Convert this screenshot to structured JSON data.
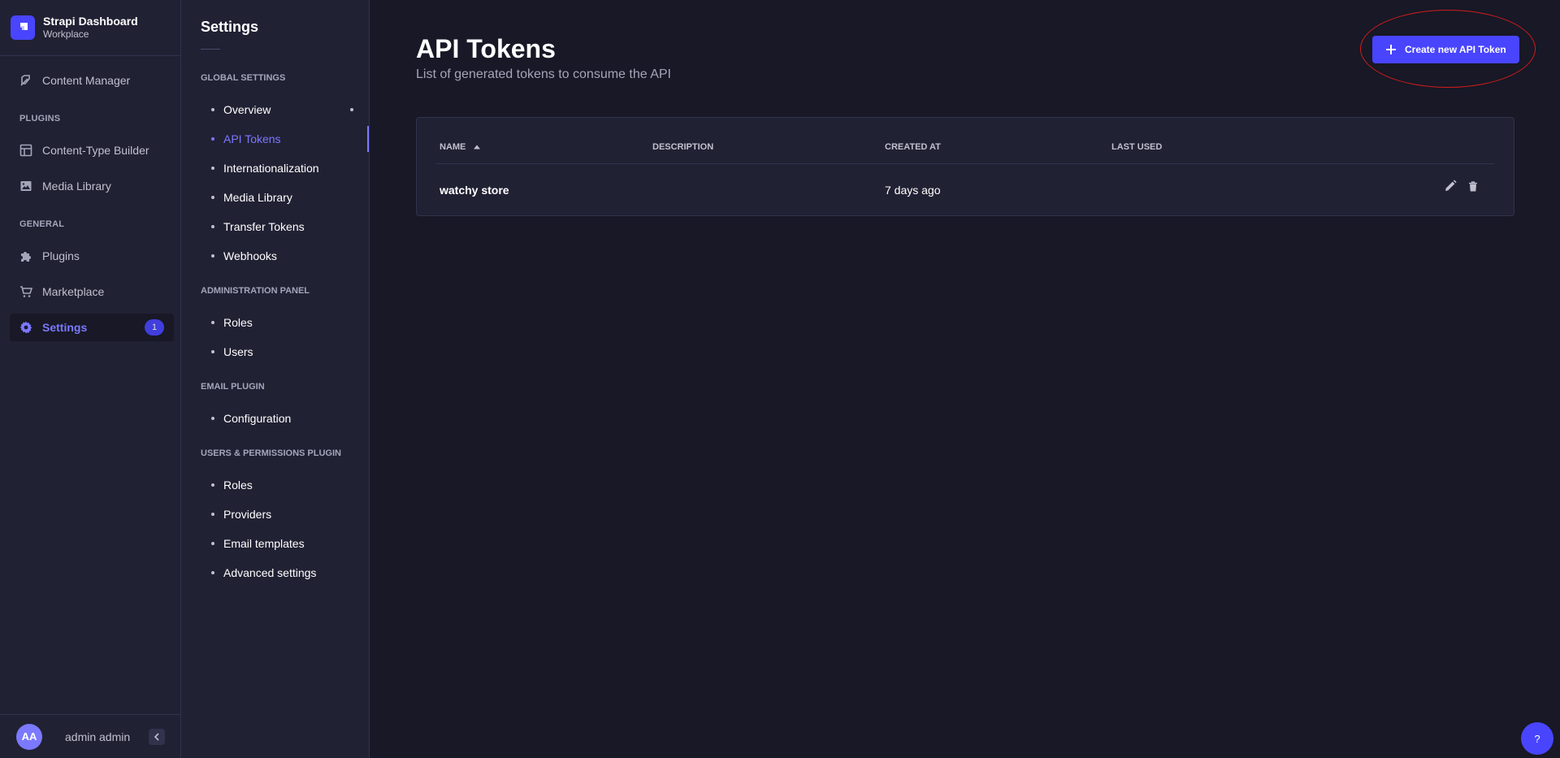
{
  "brand": {
    "title": "Strapi Dashboard",
    "subtitle": "Workplace"
  },
  "mainnav": {
    "content_manager": "Content Manager",
    "plugins_section": "PLUGINS",
    "ctb": "Content-Type Builder",
    "media_library": "Media Library",
    "general_section": "GENERAL",
    "plugins": "Plugins",
    "marketplace": "Marketplace",
    "settings": "Settings",
    "settings_badge": "1"
  },
  "user": {
    "initials": "AA",
    "name": "admin admin"
  },
  "subnav": {
    "title": "Settings",
    "global_section": "GLOBAL SETTINGS",
    "overview": "Overview",
    "api_tokens": "API Tokens",
    "i18n": "Internationalization",
    "media_library": "Media Library",
    "transfer_tokens": "Transfer Tokens",
    "webhooks": "Webhooks",
    "admin_section": "ADMINISTRATION PANEL",
    "admin_roles": "Roles",
    "admin_users": "Users",
    "email_section": "EMAIL PLUGIN",
    "email_config": "Configuration",
    "up_section": "USERS & PERMISSIONS PLUGIN",
    "up_roles": "Roles",
    "up_providers": "Providers",
    "up_email_templates": "Email templates",
    "up_advanced": "Advanced settings"
  },
  "page": {
    "title": "API Tokens",
    "subtitle": "List of generated tokens to consume the API",
    "create_button": "Create new API Token"
  },
  "table": {
    "headers": {
      "name": "NAME",
      "description": "DESCRIPTION",
      "created_at": "CREATED AT",
      "last_used": "LAST USED"
    },
    "rows": [
      {
        "name": "watchy store",
        "description": "",
        "created_at": "7 days ago",
        "last_used": ""
      }
    ]
  },
  "help": {
    "label": "?"
  },
  "colors": {
    "primary": "#4945ff",
    "accent": "#7b79ff",
    "background": "#181826",
    "surface": "#212134",
    "annotation": "#d01c1c"
  }
}
